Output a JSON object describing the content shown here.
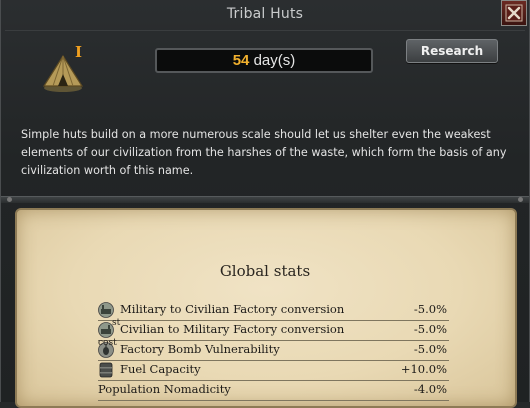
{
  "window": {
    "title": "Tribal Huts"
  },
  "tech": {
    "tier_mark": "I",
    "days_value": "54",
    "days_unit": "day(s)",
    "research_label": "Research",
    "description": "Simple huts build on a more numerous scale should let us shelter even the weakest elements of our civilization from the harshes of the waste, which form the basis of any civilization worth of this name."
  },
  "global_stats": {
    "title": "Global stats",
    "rows": [
      {
        "icon": "factory-icon",
        "label": "Military to Civilian Factory conversion",
        "value": "-5.0%"
      },
      {
        "icon": "factory-icon",
        "label": "Civilian to Military Factory conversion",
        "value": "-5.0%"
      },
      {
        "icon": "bomb-icon",
        "label": "Factory Bomb Vulnerability",
        "value": "-5.0%"
      },
      {
        "icon": "fuel-barrel-icon",
        "label": "Fuel Capacity",
        "value": "+10.0%"
      },
      {
        "icon": "",
        "label": "Population Nomadicity",
        "value": "-4.0%"
      }
    ],
    "overlap_fragments": [
      "st",
      "cost"
    ]
  },
  "colors": {
    "accent": "#f2b12e",
    "parchment": "#ecdcb9",
    "panel": "#222526"
  }
}
